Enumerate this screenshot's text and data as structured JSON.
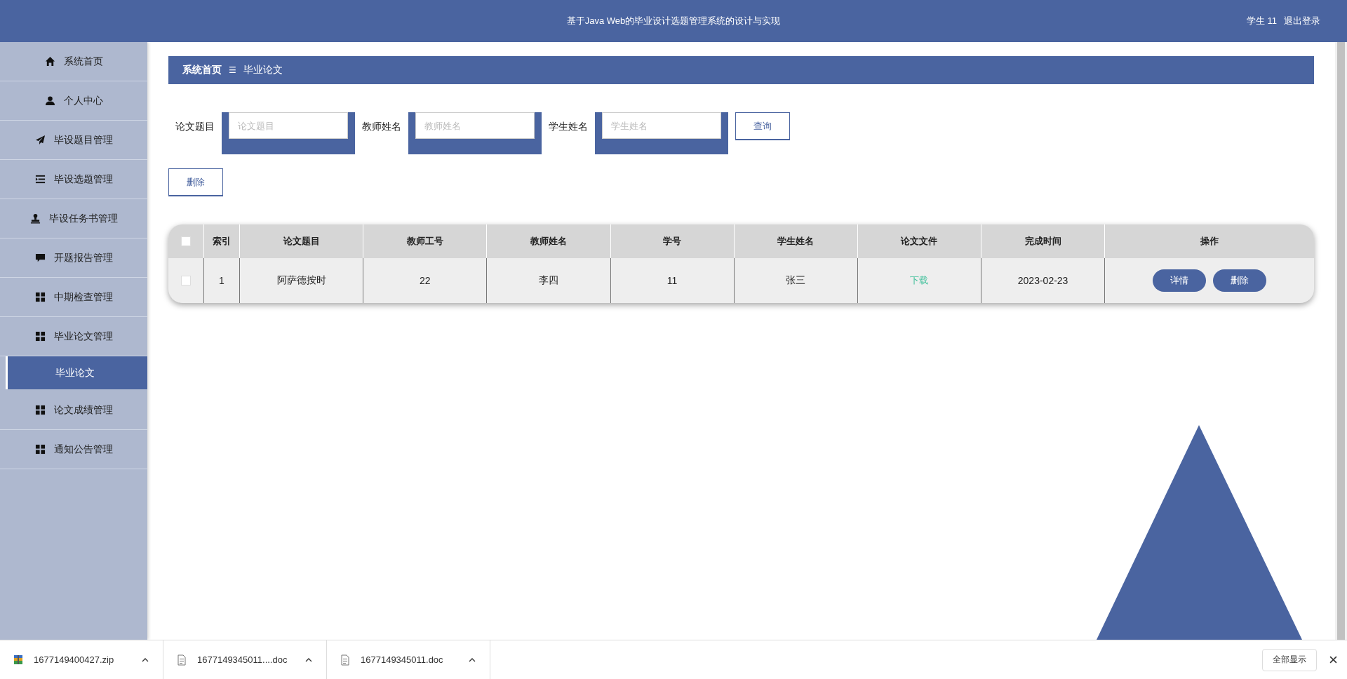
{
  "header": {
    "title": "基于Java Web的毕业设计选题管理系统的设计与实现",
    "user": "学生 11",
    "logout": "退出登录"
  },
  "sidebar": {
    "items": [
      {
        "label": "系统首页",
        "kind": "home",
        "selected": false
      },
      {
        "label": "个人中心",
        "kind": "user",
        "selected": false
      },
      {
        "label": "毕设题目管理",
        "kind": "plane",
        "selected": false
      },
      {
        "label": "毕设选题管理",
        "kind": "list",
        "selected": false
      },
      {
        "label": "毕设任务书管理",
        "kind": "stamp",
        "selected": false
      },
      {
        "label": "开题报告管理",
        "kind": "chat",
        "selected": false
      },
      {
        "label": "中期检查管理",
        "kind": "grid",
        "selected": false
      },
      {
        "label": "毕业论文管理",
        "kind": "grid",
        "selected": false,
        "expanded": true,
        "children": [
          {
            "label": "毕业论文",
            "selected": true
          }
        ]
      },
      {
        "label": "论文成绩管理",
        "kind": "grid",
        "selected": false
      },
      {
        "label": "通知公告管理",
        "kind": "grid",
        "selected": false
      }
    ]
  },
  "breadcrumb": {
    "home": "系统首页",
    "separator": "☰",
    "current": "毕业论文"
  },
  "search": {
    "fields": [
      {
        "label": "论文题目",
        "placeholder": "论文题目"
      },
      {
        "label": "教师姓名",
        "placeholder": "教师姓名"
      },
      {
        "label": "学生姓名",
        "placeholder": "学生姓名"
      }
    ],
    "button": "查询"
  },
  "delete_button": "删除",
  "table": {
    "header_checked": false,
    "columns": [
      "索引",
      "论文题目",
      "教师工号",
      "教师姓名",
      "学号",
      "学生姓名",
      "论文文件",
      "完成时间",
      "操作"
    ],
    "rows": [
      {
        "checked": false,
        "cells": [
          "1",
          "阿萨德按时",
          "22",
          "李四",
          "11",
          "张三"
        ],
        "file_link": "下载",
        "date": "2023-02-23",
        "actions": [
          "详情",
          "删除"
        ]
      }
    ]
  },
  "downloads": {
    "items": [
      {
        "name": "1677149400427.zip",
        "kind": "zip"
      },
      {
        "name": "1677149345011....doc",
        "kind": "doc"
      },
      {
        "name": "1677149345011.doc",
        "kind": "doc"
      }
    ],
    "show_all": "全部显示"
  }
}
